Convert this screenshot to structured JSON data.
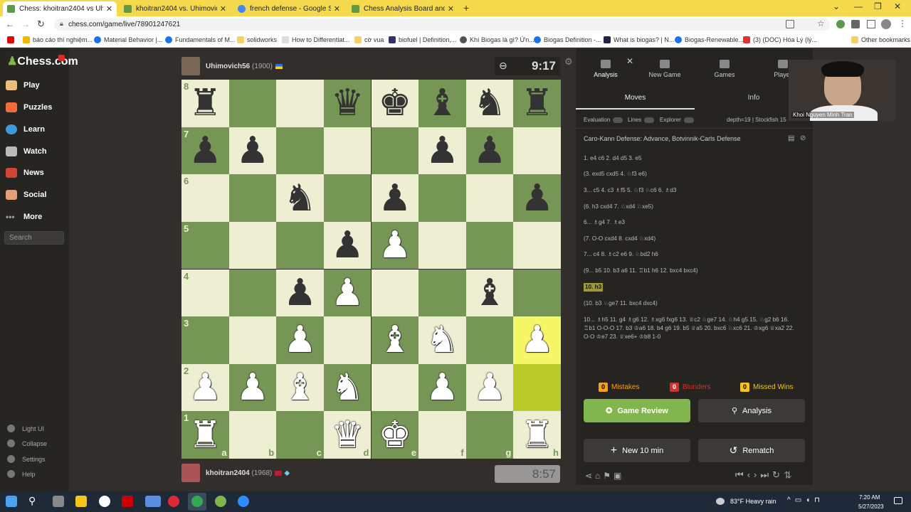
{
  "browser": {
    "tabs": [
      {
        "title": "Chess: khoitran2404 vs Uhimovic",
        "fav": "#5d9948"
      },
      {
        "title": "khoitran2404 vs. Uhimovich56 | c",
        "fav": "#5d9948"
      },
      {
        "title": "french defense - Google Search",
        "fav": "#4285f4"
      },
      {
        "title": "Chess Analysis Board and PGN E",
        "fav": "#5d9948"
      }
    ],
    "url": "chess.com/game/live/78901247621",
    "bookmarks": [
      "báo cáo thí nghiệm...",
      "Material Behavior |...",
      "Fundamentals of M...",
      "solidworks",
      "How to Differentiat...",
      "cờ vua",
      "biofuel | Definition,...",
      "Khí Biogas là gì? Ứn...",
      "Biogas Definition -...",
      "What is biogas? | N...",
      "Biogas-Renewable...",
      "(3) (DOC) Hóa Lý (lý...",
      "Other bookmarks"
    ]
  },
  "site": {
    "logo": "Chess.com",
    "nav": [
      "Play",
      "Puzzles",
      "Learn",
      "Watch",
      "News",
      "Social",
      "More"
    ],
    "search_placeholder": "Search",
    "footer": [
      "Light UI",
      "Collapse",
      "Settings",
      "Help"
    ]
  },
  "players": {
    "top": {
      "name": "Uhimovich56",
      "rating": "(1900)",
      "clock": "9:17"
    },
    "bottom": {
      "name": "khoitran2404",
      "rating": "(1968)",
      "clock": "8:57"
    }
  },
  "board": {
    "ranks": [
      "8",
      "7",
      "6",
      "5",
      "4",
      "3",
      "2",
      "1"
    ],
    "files": [
      "a",
      "b",
      "c",
      "d",
      "e",
      "f",
      "g",
      "h"
    ],
    "position": [
      [
        "bR",
        "",
        "",
        "bQ",
        "bK",
        "bB",
        "bN",
        "bR"
      ],
      [
        "bP",
        "bP",
        "",
        "",
        "",
        "bP",
        "bP",
        ""
      ],
      [
        "",
        "",
        "bN",
        "",
        "bP",
        "",
        "",
        "bP"
      ],
      [
        "",
        "",
        "",
        "bP",
        "wP",
        "",
        "",
        ""
      ],
      [
        "",
        "",
        "bP",
        "wP",
        "",
        "",
        "bB",
        ""
      ],
      [
        "",
        "",
        "wP",
        "",
        "wB",
        "wN",
        "",
        "wP"
      ],
      [
        "wP",
        "wP",
        "wB",
        "wN",
        "",
        "wP",
        "wP",
        ""
      ],
      [
        "wR",
        "",
        "",
        "wQ",
        "wK",
        "",
        "",
        "wR"
      ]
    ]
  },
  "panel": {
    "tabs": [
      "Analysis",
      "New Game",
      "Games",
      "Player"
    ],
    "subtabs": [
      "Moves",
      "Info"
    ],
    "toggles": [
      "Evaluation",
      "Lines",
      "Explorer"
    ],
    "engine": "depth=19 | Stockfish 15",
    "opening": "Caro-Kann Defense: Advance, Botvinnik-Carls Defense",
    "lines": [
      "1. e4 c6 2. d4 d5 3. e5",
      "(3. exd5 cxd5 4. ♘f3 e6)",
      "3... c5 4. c3 ♗f5 5. ♘f3 ♘c6 6. ♗d3",
      "(6. h3 cxd4 7. ♘xd4 ♘xe5)",
      "6... ♗g4 7. ♗e3",
      "(7. O-O cxd4 8. cxd4 ♘xd4)",
      "7... c4 8. ♗c2 e6 9. ♘bd2 h6",
      "(9... b5 10. b3 a6 11. ♖b1 h6 12. bxc4 bxc4)",
      "10. h3",
      "(10. b3 ♘ge7 11. bxc4 dxc4)",
      "10... ♗h5 11. g4 ♗g6 12. ♗xg6 fxg6 13. ♕c2 ♘ge7 14. ♘h4 g5 15. ♘g2 b6 16. ♖b1 O-O-O 17. b3 ♔a6 18. b4 g6 19. b5 ♕a5 20. bxc6 ♘xc6 21. ♔xg6 ♕xa2 22. O-O ♔e7 23. ♕xe6+ ♔b8 1-0"
    ],
    "stats": [
      {
        "count": "0",
        "label": "Mistakes",
        "color": "#f7a01d"
      },
      {
        "count": "0",
        "label": "Blunders",
        "color": "#ca3431"
      },
      {
        "count": "0",
        "label": "Missed Wins",
        "color": "#f5c518"
      }
    ],
    "buttons": {
      "review": "Game Review",
      "analysis": "Analysis",
      "new": "New 10 min",
      "rematch": "Rematch"
    }
  },
  "webcam": {
    "name": "Khoi Nguyen Minh Tran"
  },
  "taskbar": {
    "weather": "83°F  Heavy rain",
    "time": "7:20 AM",
    "date": "5/27/2023"
  }
}
